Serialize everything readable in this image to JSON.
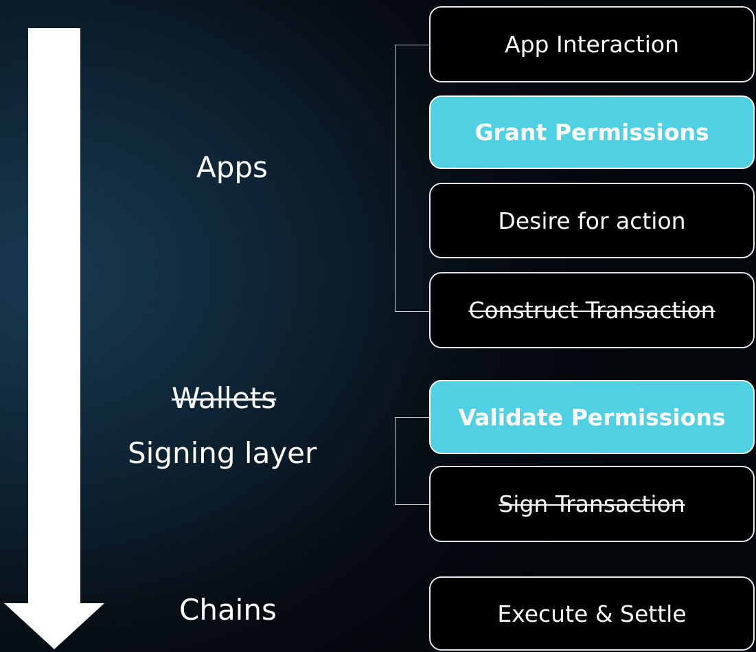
{
  "layers": {
    "apps": "Apps",
    "wallets_struck": "Wallets",
    "signing": "Signing layer",
    "chains": "Chains"
  },
  "steps": {
    "app_interaction": "App Interaction",
    "grant_permissions": "Grant Permissions",
    "desire_for_action": "Desire for action",
    "construct_transaction": "Construct Transaction",
    "validate_permissions": "Validate Permissions",
    "sign_transaction": "Sign Transaction",
    "execute_settle": "Execute & Settle"
  },
  "colors": {
    "highlight": "#4fd0e3",
    "box_fill": "#000000",
    "box_border": "#e6eaee",
    "arrow": "#ffffff"
  }
}
